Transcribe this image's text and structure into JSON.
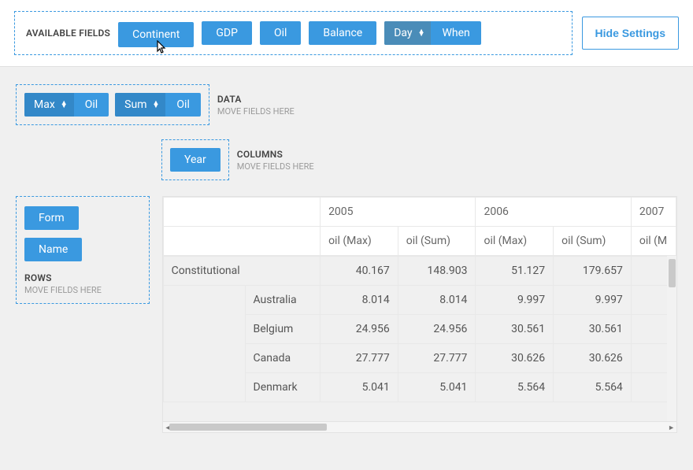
{
  "header": {
    "available_fields_label": "AVAILABLE FIELDS",
    "fields": [
      "Continent",
      "GDP",
      "Oil",
      "Balance"
    ],
    "split_field": {
      "agg": "Day",
      "field": "When"
    },
    "hide_settings": "Hide Settings"
  },
  "zones": {
    "data": {
      "label": "DATA",
      "hint": "MOVE FIELDS HERE",
      "items": [
        {
          "agg": "Max",
          "field": "Oil"
        },
        {
          "agg": "Sum",
          "field": "Oil"
        }
      ]
    },
    "columns": {
      "label": "COLUMNS",
      "hint": "MOVE FIELDS HERE",
      "items": [
        "Year"
      ]
    },
    "rows": {
      "label": "ROWS",
      "hint": "MOVE FIELDS HERE",
      "items": [
        "Form",
        "Name"
      ]
    }
  },
  "pivot": {
    "year_headers": [
      "2005",
      "2006",
      "2007"
    ],
    "sub_headers": [
      "oil (Max)",
      "oil (Sum)",
      "oil (Max)",
      "oil (Sum)",
      "oil (M"
    ],
    "rows": [
      {
        "form": "Constitutional",
        "name": "",
        "vals": [
          "40.167",
          "148.903",
          "51.127",
          "179.657",
          ""
        ]
      },
      {
        "form": "",
        "name": "Australia",
        "vals": [
          "8.014",
          "8.014",
          "9.997",
          "9.997",
          ""
        ]
      },
      {
        "form": "",
        "name": "Belgium",
        "vals": [
          "24.956",
          "24.956",
          "30.561",
          "30.561",
          ""
        ]
      },
      {
        "form": "",
        "name": "Canada",
        "vals": [
          "27.777",
          "27.777",
          "30.626",
          "30.626",
          ""
        ]
      },
      {
        "form": "",
        "name": "Denmark",
        "vals": [
          "5.041",
          "5.041",
          "5.564",
          "5.564",
          ""
        ]
      }
    ]
  }
}
